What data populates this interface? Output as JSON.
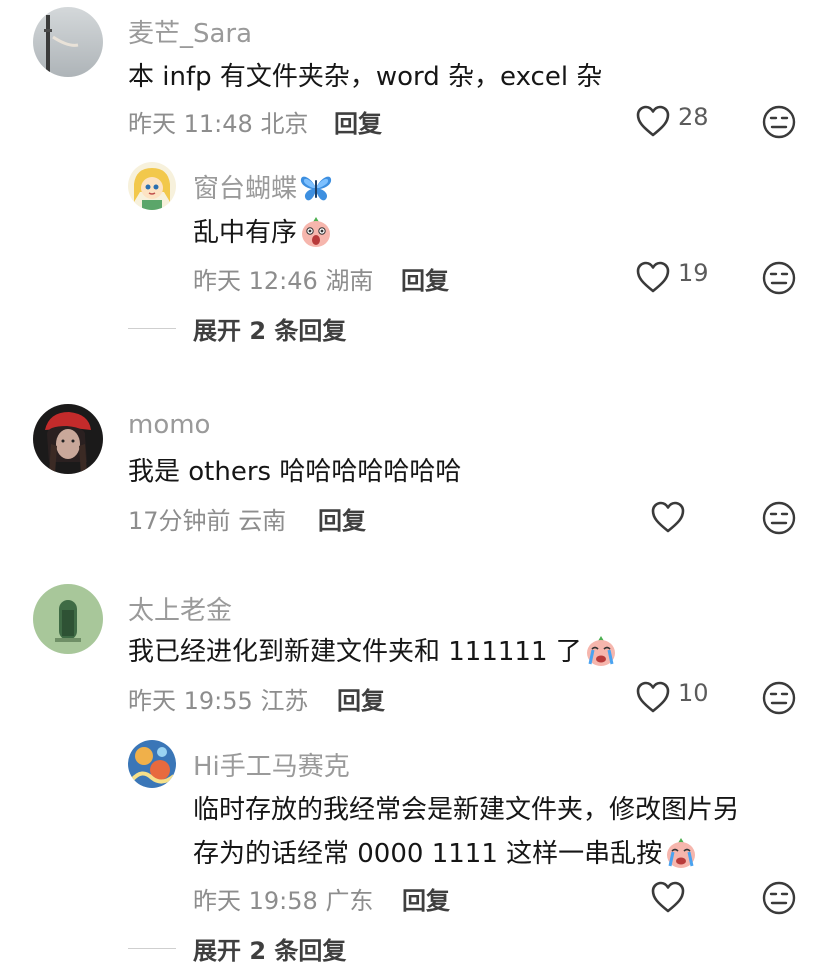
{
  "comments": [
    {
      "username": "麦芒_Sara",
      "text": "本 infp 有文件夹杂，word 杂，excel 杂",
      "time": "昨天 11:48",
      "location": "北京",
      "reply_label": "回复",
      "like_count": "28",
      "avatar_icon": "sky-tower-photo",
      "replies": [
        {
          "username": "窗台蝴蝶",
          "username_emoji": "butterfly-emoji",
          "text": "乱中有序",
          "text_emoji": "screaming-face-emoji",
          "time": "昨天 12:46",
          "location": "湖南",
          "reply_label": "回复",
          "like_count": "19",
          "avatar_icon": "cartoon-girl-avatar"
        }
      ],
      "expand_label": "展开 2 条回复"
    },
    {
      "username": "momo",
      "text": "我是 others 哈哈哈哈哈哈哈",
      "time": "17分钟前",
      "location": "云南",
      "reply_label": "回复",
      "like_count": "",
      "avatar_icon": "red-beret-portrait"
    },
    {
      "username": "太上老金",
      "text": "我已经进化到新建文件夹和 111111 了",
      "text_emoji": "crying-face-emoji",
      "time": "昨天 19:55",
      "location": "江苏",
      "reply_label": "回复",
      "like_count": "10",
      "avatar_icon": "green-door-photo",
      "replies": [
        {
          "username": "Hi手工马赛克",
          "text_line1": "临时存放的我经常会是新建文件夹，修改图片另",
          "text_line2": "存为的话经常 0000 1111 这样一串乱按",
          "text_emoji": "crying-face-emoji",
          "time": "昨天 19:58",
          "location": "广东",
          "reply_label": "回复",
          "like_count": "",
          "avatar_icon": "mosaic-art-avatar"
        }
      ],
      "expand_label": "展开 2 条回复"
    }
  ],
  "colors": {
    "username": "#9a9a9a",
    "meta": "#8d8d8d",
    "text": "#161616",
    "icon": "#3a3a3a"
  }
}
